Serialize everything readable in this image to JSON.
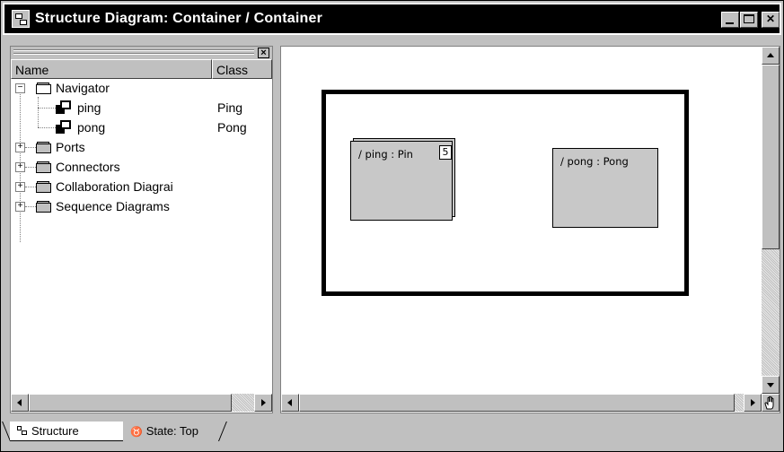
{
  "window": {
    "title": "Structure Diagram: Container / Container",
    "icon": "structure-diagram-icon"
  },
  "browser": {
    "columns": {
      "name": "Name",
      "class": "Class"
    },
    "tree": [
      {
        "label": "Navigator",
        "class": "",
        "type": "folder",
        "expanded": true,
        "icon": "folder-open-icon"
      },
      {
        "label": "ping",
        "class": "Ping",
        "type": "capsule-role",
        "icon": "capsule-role-icon"
      },
      {
        "label": "pong",
        "class": "Pong",
        "type": "capsule-role",
        "icon": "capsule-role-icon"
      },
      {
        "label": "Ports",
        "class": "",
        "type": "folder",
        "expanded": false,
        "icon": "folder-icon"
      },
      {
        "label": "Connectors",
        "class": "",
        "type": "folder",
        "expanded": false,
        "icon": "folder-icon"
      },
      {
        "label": "Collaboration Diagrai",
        "class": "",
        "type": "folder",
        "expanded": false,
        "icon": "folder-icon"
      },
      {
        "label": "Sequence Diagrams",
        "class": "",
        "type": "folder",
        "expanded": false,
        "icon": "folder-icon"
      }
    ]
  },
  "diagram": {
    "parts": [
      {
        "label": "/ ping : Pin",
        "multiplicity": "5",
        "replicated": true
      },
      {
        "label": "/ pong : Pong",
        "replicated": false
      }
    ]
  },
  "tabs": [
    {
      "label": "Structure",
      "active": true,
      "icon": "structure-icon"
    },
    {
      "label": "State: Top",
      "active": false,
      "icon": "state-icon"
    }
  ],
  "colors": {
    "title_bar": "#000000",
    "chrome": "#c0c0c0",
    "part_fill": "#c8c8c8"
  }
}
